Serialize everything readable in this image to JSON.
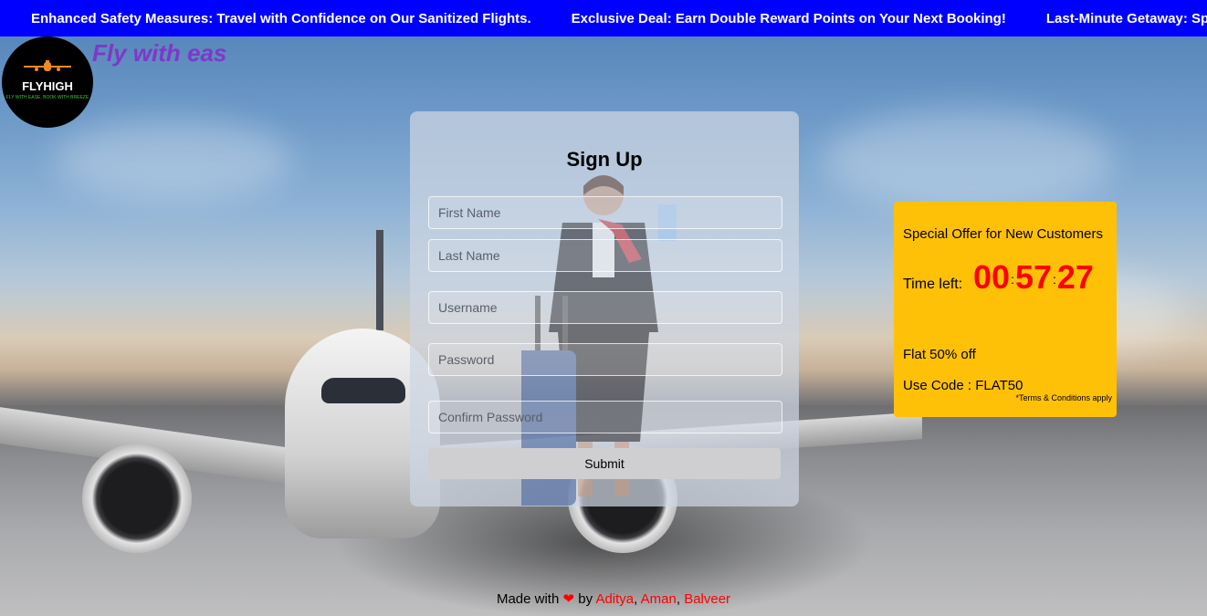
{
  "ticker": {
    "items": [
      "!",
      "Enhanced Safety Measures: Travel with Confidence on Our Sanitized Flights.",
      "Exclusive Deal: Earn Double Reward Points on Your Next Booking!",
      "Last-Minute Getaway: Special Dis"
    ],
    "background_color": "#0000ff"
  },
  "brand": {
    "logo_text": "FLYHIGH",
    "logo_tagline": "FLY WITH EASE, BOOK WITH BREEZE",
    "tagline": "Fly with eas",
    "tagline_color": "#7e38c9"
  },
  "signup": {
    "title": "Sign Up",
    "fields": {
      "first_name": "First Name",
      "last_name": "Last Name",
      "username": "Username",
      "password": "Password",
      "confirm_password": "Confirm Password"
    },
    "submit_label": "Submit"
  },
  "offer": {
    "title": "Special Offer for New Customers",
    "timer_label": "Time left:",
    "hours": "00",
    "minutes": "57",
    "seconds": "27",
    "separator": ":",
    "discount": "Flat 50% off",
    "code": "Use Code : FLAT50",
    "terms": "*Terms & Conditions apply",
    "background_color": "#ffc107",
    "timer_color": "#ff0000"
  },
  "footer": {
    "prefix": "Made with",
    "heart": "❤",
    "by": "by",
    "authors": [
      "Aditya",
      "Aman",
      "Balveer"
    ],
    "comma": ","
  }
}
